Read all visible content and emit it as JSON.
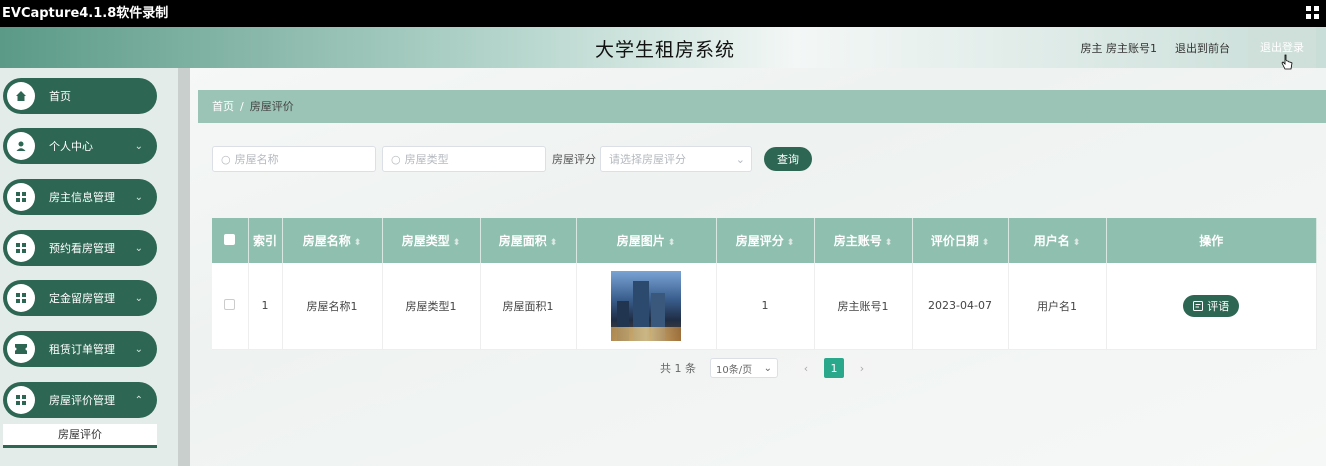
{
  "recorder": {
    "title": "EVCapture4.1.8软件录制"
  },
  "header": {
    "title": "大学生租房系统",
    "user": "房主 房主账号1",
    "back_to_front": "退出到前台",
    "logout": "退出登录"
  },
  "sidebar": {
    "items": [
      {
        "label": "首页",
        "icon": "home-icon",
        "has_caret": false
      },
      {
        "label": "个人中心",
        "icon": "user-icon",
        "has_caret": true
      },
      {
        "label": "房主信息管理",
        "icon": "grid-icon",
        "has_caret": true
      },
      {
        "label": "预约看房管理",
        "icon": "grid-icon",
        "has_caret": true
      },
      {
        "label": "定金留房管理",
        "icon": "grid-icon",
        "has_caret": true
      },
      {
        "label": "租赁订单管理",
        "icon": "ticket-icon",
        "has_caret": true
      },
      {
        "label": "房屋评价管理",
        "icon": "grid-icon",
        "has_caret": true
      }
    ],
    "submenu_active": "房屋评价"
  },
  "breadcrumb": {
    "home": "首页",
    "current": "房屋评价"
  },
  "search": {
    "name_placeholder": "房屋名称",
    "type_placeholder": "房屋类型",
    "rating_label": "房屋评分",
    "rating_placeholder": "请选择房屋评分",
    "query_button": "查询"
  },
  "table": {
    "headers": [
      "索引",
      "房屋名称",
      "房屋类型",
      "房屋面积",
      "房屋图片",
      "房屋评分",
      "房主账号",
      "评价日期",
      "用户名",
      "操作"
    ],
    "rows": [
      {
        "index": "1",
        "name": "房屋名称1",
        "type": "房屋类型1",
        "area": "房屋面积1",
        "image": "house-photo",
        "rating": "1",
        "owner": "房主账号1",
        "date": "2023-04-07",
        "username": "用户名1",
        "action": "评语"
      }
    ]
  },
  "pagination": {
    "total": "共 1 条",
    "page_size": "10条/页",
    "current_page": "1"
  },
  "colors": {
    "primary": "#2d6653",
    "header_row": "#8fbfae",
    "breadcrumb": "#9bc4b6",
    "active_page": "#2aa88c"
  }
}
